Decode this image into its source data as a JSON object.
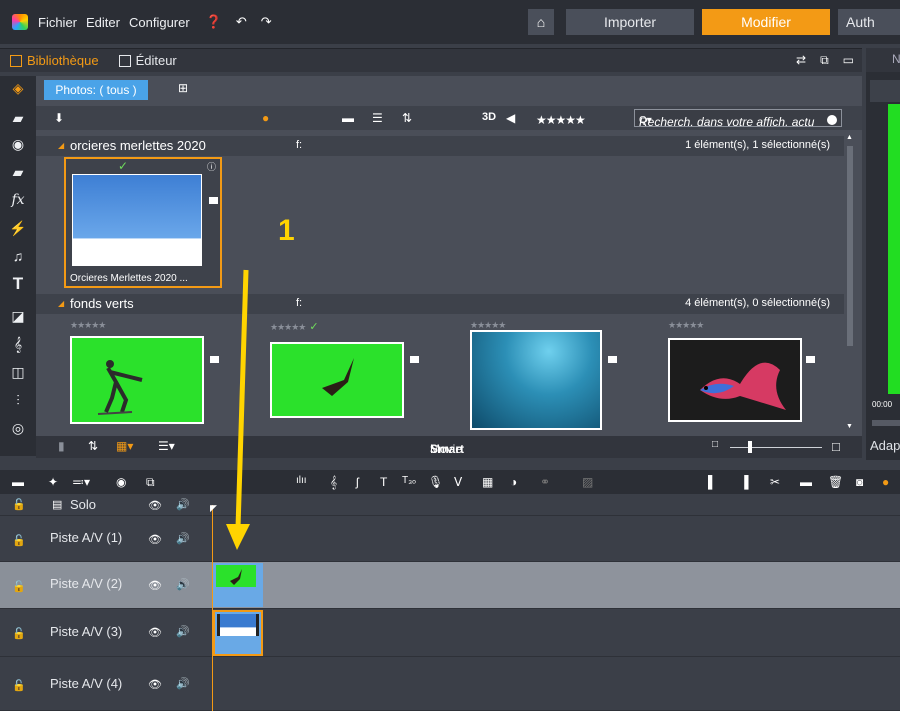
{
  "menu": {
    "fichier": "Fichier",
    "editer": "Editer",
    "configurer": "Configurer"
  },
  "modes": {
    "importer": "Importer",
    "modifier": "Modifier",
    "authoring": "Auth"
  },
  "library_tabs": {
    "bibliotheque": "Bibliothèque",
    "editeur": "Éditeur"
  },
  "library": {
    "photos_tab": "Photos: ( tous )",
    "threed": "3D",
    "search_placeholder": "Recherch. dans votre affich. actu",
    "groups": [
      {
        "title": "orcieres merlettes 2020",
        "f": "f:",
        "count": "1 élément(s), 1 sélectionné(s)",
        "items": [
          {
            "caption": "Orcieres Merlettes 2020 ..."
          }
        ]
      },
      {
        "title": "fonds verts",
        "f": "f:",
        "count": "4 élément(s), 0 sélectionné(s)",
        "items": [
          {
            "kind": "skier-green"
          },
          {
            "kind": "eagle-green"
          },
          {
            "kind": "underwater"
          },
          {
            "kind": "betta-fish"
          }
        ]
      }
    ],
    "stars": "★★★★★"
  },
  "library_bottom": {
    "smartmovie_smart": "Smart",
    "smartmovie_movie": "Movie"
  },
  "preview": {
    "time": "00:00",
    "adapt": "Adap"
  },
  "annotation": {
    "step": "1"
  },
  "timeline": {
    "solo": "Solo",
    "tracks": [
      {
        "name": "Piste A/V (1)",
        "selected": false
      },
      {
        "name": "Piste A/V (2)",
        "selected": true
      },
      {
        "name": "Piste A/V (3)",
        "selected": false
      },
      {
        "name": "Piste A/V (4)",
        "selected": false
      }
    ]
  },
  "colors": {
    "accent": "#f39a15",
    "selection_blue": "#4aa3e8",
    "annotation_yellow": "#ffd400"
  }
}
